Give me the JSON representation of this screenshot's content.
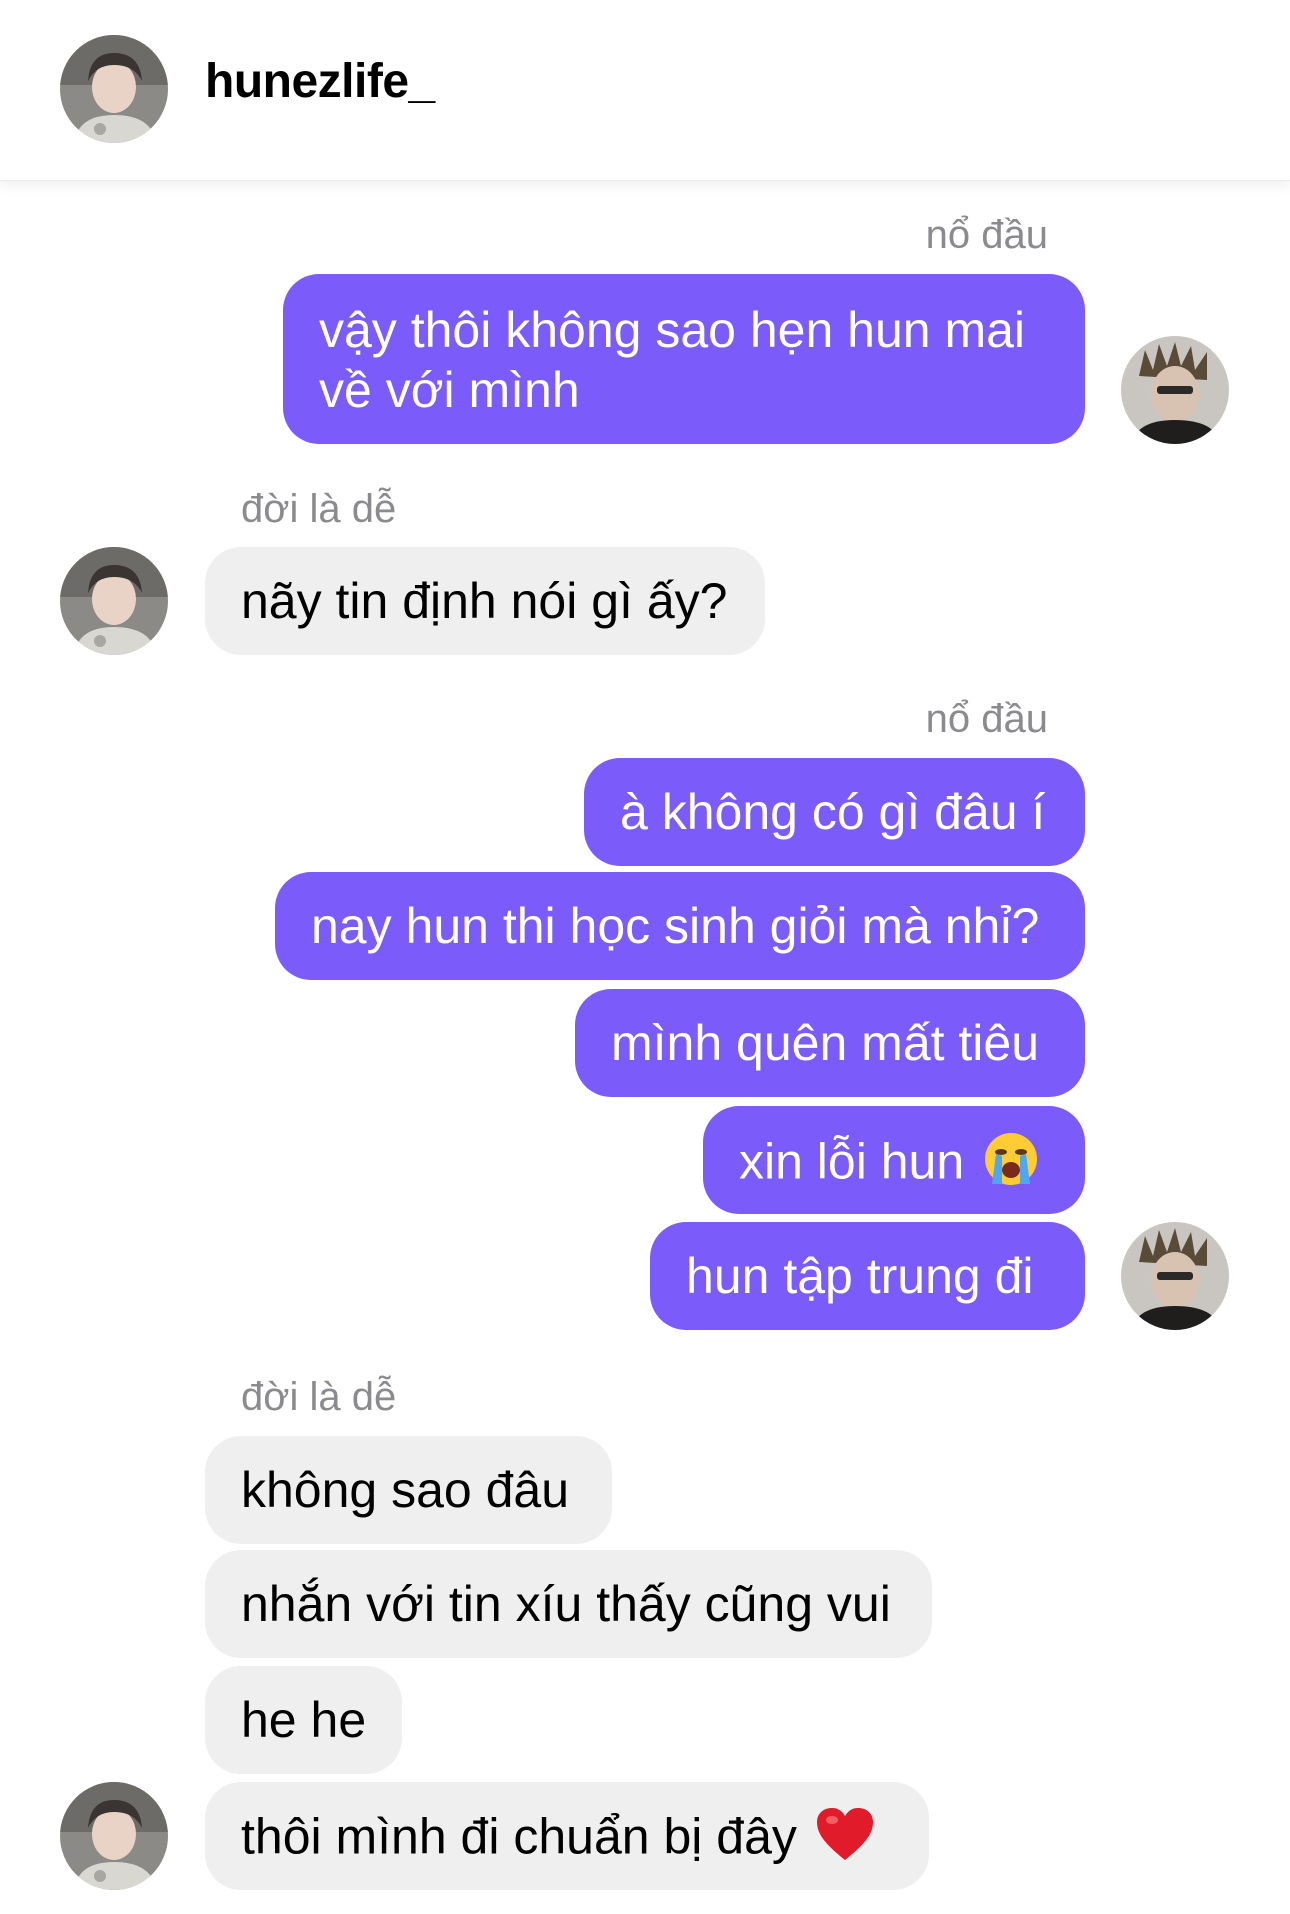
{
  "header": {
    "username": "hunezlife_"
  },
  "colors": {
    "outgoing_bubble": "#7b5cfb",
    "incoming_bubble": "#efeff0",
    "sender_label": "#8a8a8f"
  },
  "messages": [
    {
      "sender": "nổ đầu",
      "lines": [
        "vậy thôi không sao hẹn hun mai",
        "về với mình"
      ]
    },
    {
      "sender": "đời là dễ",
      "text": "nãy tin định nói gì ấy?"
    },
    {
      "sender": "nổ đầu",
      "texts": [
        "à không có gì đâu í",
        "nay hun thi học sinh giỏi mà nhỉ?",
        "mình quên mất tiêu",
        "xin lỗi hun",
        "hun tập trung đi"
      ],
      "emoji": "loudly-crying-face-icon"
    },
    {
      "sender": "đời là dễ",
      "texts": [
        "không sao đâu",
        "nhắn với tin xíu thấy cũng vui",
        "he he",
        "thôi mình đi chuẩn bị đây"
      ],
      "emoji": "red-heart-icon"
    }
  ]
}
